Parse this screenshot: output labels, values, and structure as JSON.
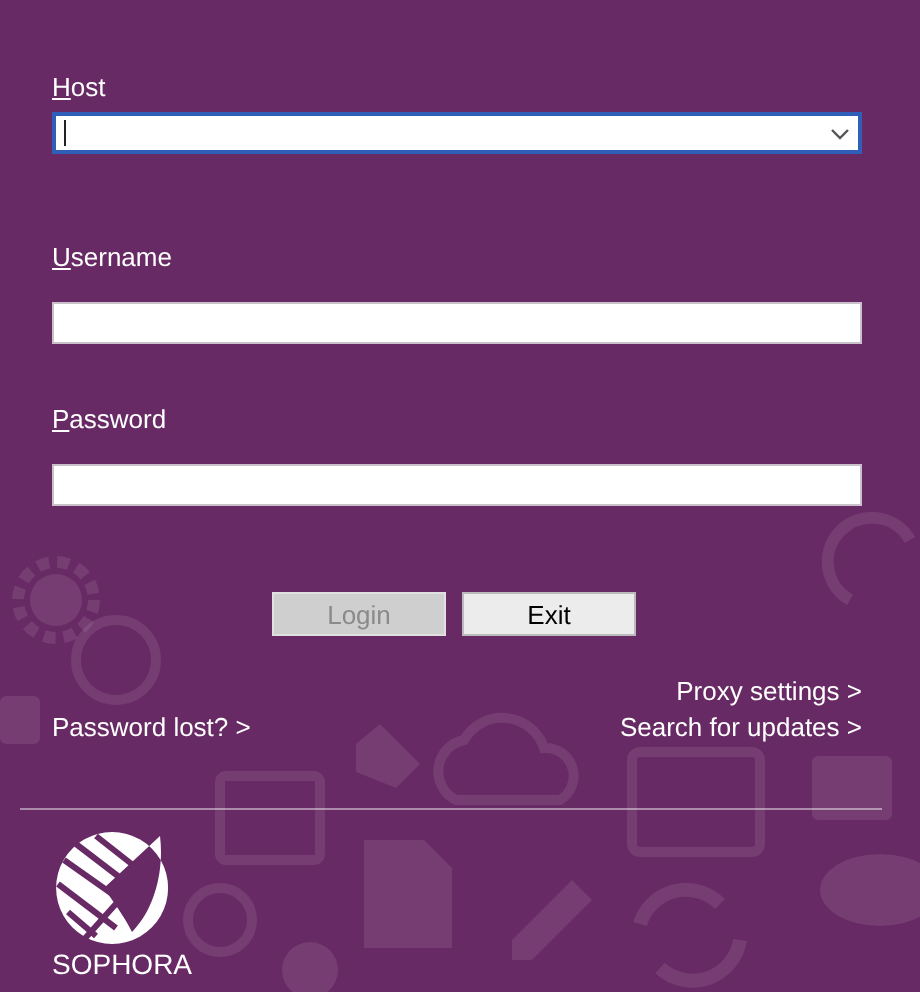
{
  "host": {
    "label": "Host",
    "focused": true,
    "dropdown": true
  },
  "fields": [
    {
      "label": "Username"
    },
    {
      "label": "Password"
    }
  ],
  "buttons": [
    {
      "label": "Login",
      "disabled": true
    },
    {
      "label": "Exit",
      "disabled": false
    }
  ],
  "links_right": [
    "Proxy settings >",
    "Search for updates >"
  ],
  "link_left": "Password lost? >",
  "logo": {
    "text": "SOPHORA"
  }
}
